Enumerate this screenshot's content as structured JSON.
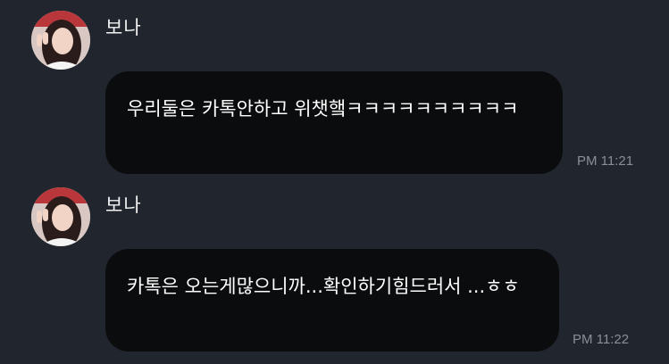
{
  "messages": [
    {
      "sender": "보나",
      "text": "우리둘은 카톡안하고 위챗햌ㅋㅋㅋㅋㅋㅋㅋㅋㅋㅋ",
      "time": "PM 11:21",
      "avatar": "profile-photo"
    },
    {
      "sender": "보나",
      "text": "카톡은 오는게많으니까...확인하기힘드러서 ...ㅎㅎ",
      "time": "PM 11:22",
      "avatar": "profile-photo"
    }
  ],
  "colors": {
    "background": "#21252d",
    "bubble": "#0b0c0e",
    "text": "#ffffff",
    "timestamp": "#8a8e96"
  }
}
